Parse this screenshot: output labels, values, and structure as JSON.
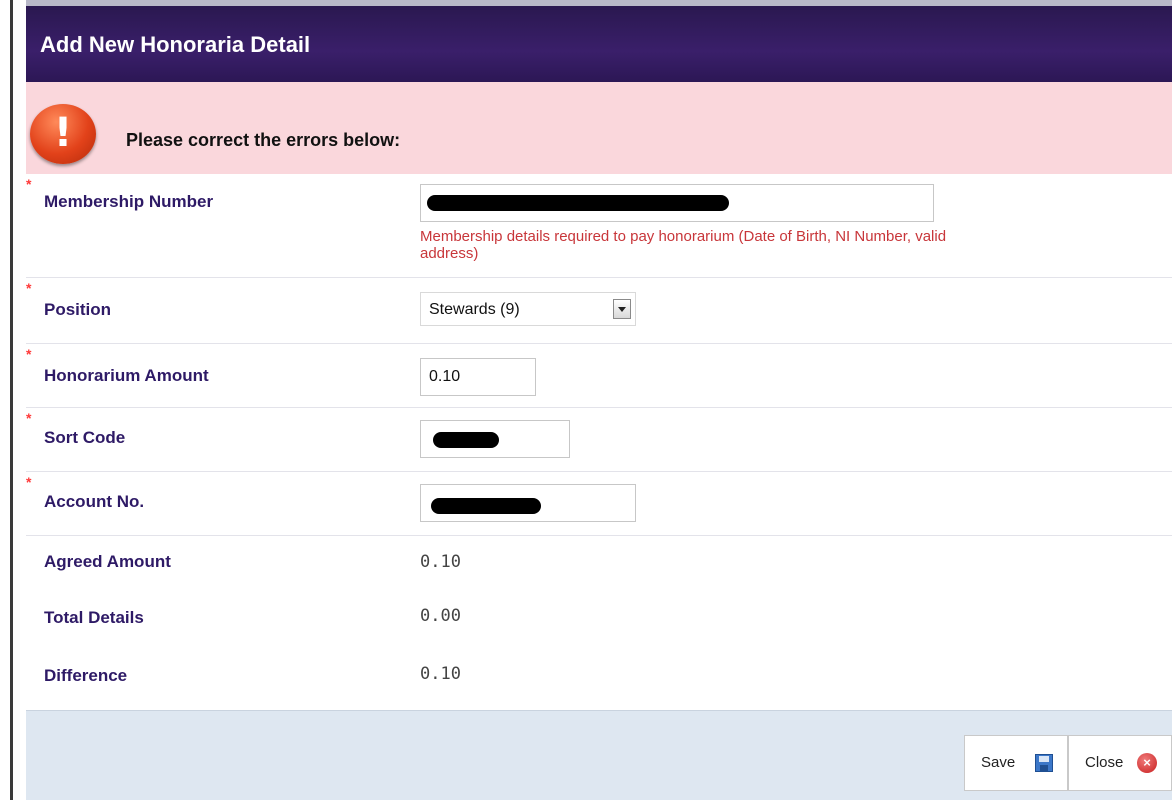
{
  "dialog": {
    "title": "Add New Honoraria Detail"
  },
  "error_panel": {
    "message": "Please correct the errors below:",
    "icon": "exclamation-icon"
  },
  "form": {
    "membership_number": {
      "label": "Membership Number",
      "value": "",
      "error": "Membership details required to pay honorarium (Date of Birth, NI Number, valid address)"
    },
    "position": {
      "label": "Position",
      "selected": "Stewards (9)"
    },
    "honorarium_amount": {
      "label": "Honorarium Amount",
      "value": "0.10"
    },
    "sort_code": {
      "label": "Sort Code",
      "value": ""
    },
    "account_no": {
      "label": "Account No.",
      "value": ""
    },
    "agreed_amount": {
      "label": "Agreed Amount",
      "value": "0.10"
    },
    "total_details": {
      "label": "Total Details",
      "value": "0.00"
    },
    "difference": {
      "label": "Difference",
      "value": "0.10"
    },
    "required_marker": "*"
  },
  "footer": {
    "save_label": "Save",
    "close_label": "Close"
  },
  "colors": {
    "title_bg": "#3a1f6a",
    "error_bg": "#fad7dc",
    "label_color": "#2e1a66",
    "error_text": "#c8363a",
    "footer_bg": "#dee7f1"
  }
}
